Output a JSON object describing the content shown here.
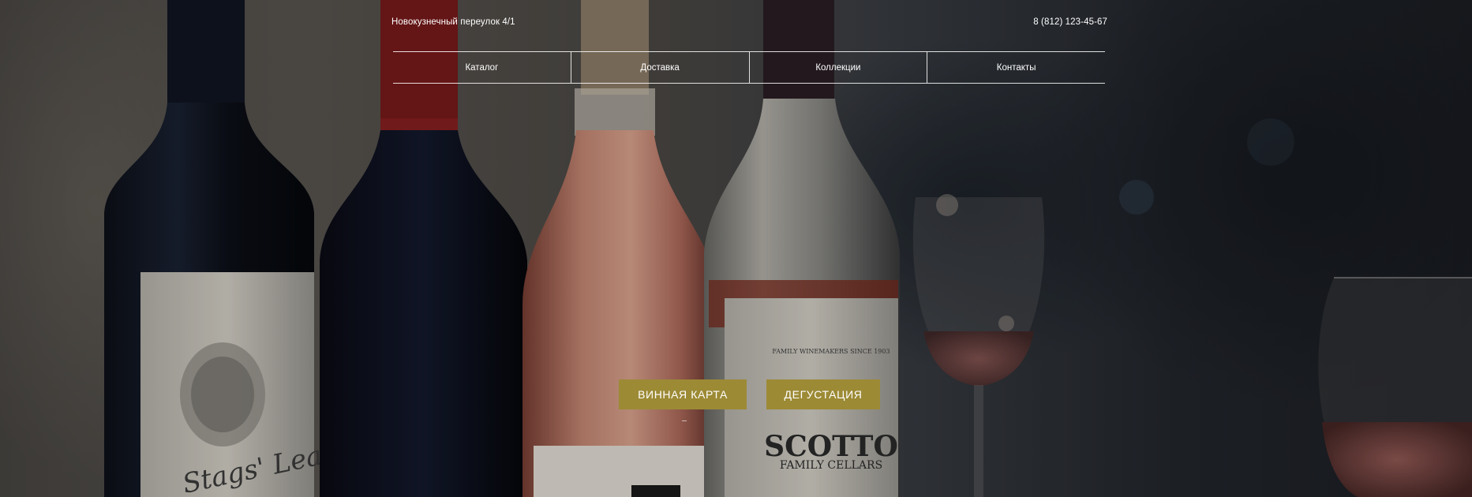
{
  "header": {
    "address": "Новокузнечный переулок 4/1",
    "phone": "8 (812) 123-45-67"
  },
  "nav": {
    "items": [
      {
        "label": "Каталог"
      },
      {
        "label": "Доставка"
      },
      {
        "label": "Коллекции"
      },
      {
        "label": "Контакты"
      }
    ]
  },
  "hero": {
    "buttons": {
      "wine_list": "ВИННАЯ КАРТА",
      "tasting": "ДЕГУСТАЦИЯ"
    },
    "bottle_labels": {
      "first": "Stags' Leap",
      "last_brand": "SCOTTO",
      "last_sub": "FAMILY CELLARS",
      "last_top": "FAMILY WINEMAKERS SINCE 1903"
    }
  },
  "colors": {
    "button_bg": "#9c8a35",
    "text": "#ffffff"
  }
}
